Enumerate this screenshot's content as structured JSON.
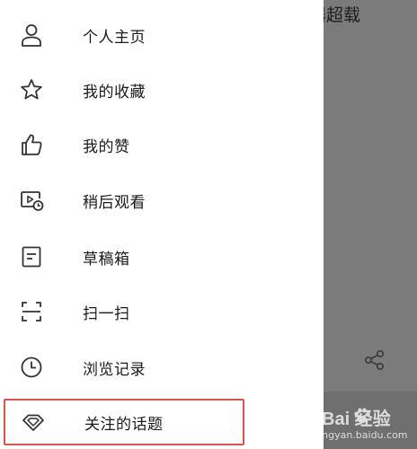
{
  "background": {
    "title": "器超载",
    "share_icon": "share-icon"
  },
  "watermark": {
    "main": "Bai  经验",
    "sub": "jingyan.baidu.com"
  },
  "drawer": {
    "items": [
      {
        "label": "个人主页",
        "icon": "person-icon"
      },
      {
        "label": "我的收藏",
        "icon": "star-icon"
      },
      {
        "label": "我的赞",
        "icon": "thumbs-up-icon"
      },
      {
        "label": "稍后观看",
        "icon": "watch-later-icon"
      },
      {
        "label": "草稿箱",
        "icon": "draft-icon"
      },
      {
        "label": "扫一扫",
        "icon": "scan-icon"
      },
      {
        "label": "浏览记录",
        "icon": "history-clock-icon"
      },
      {
        "label": "关注的话题",
        "icon": "diamond-icon",
        "highlighted": true
      }
    ]
  },
  "colors": {
    "drawer_bg": "#ffffff",
    "backdrop": "#7b7b7b",
    "text": "#1a1a1a",
    "icon_stroke": "#333333",
    "highlight_border": "#d9534f"
  }
}
